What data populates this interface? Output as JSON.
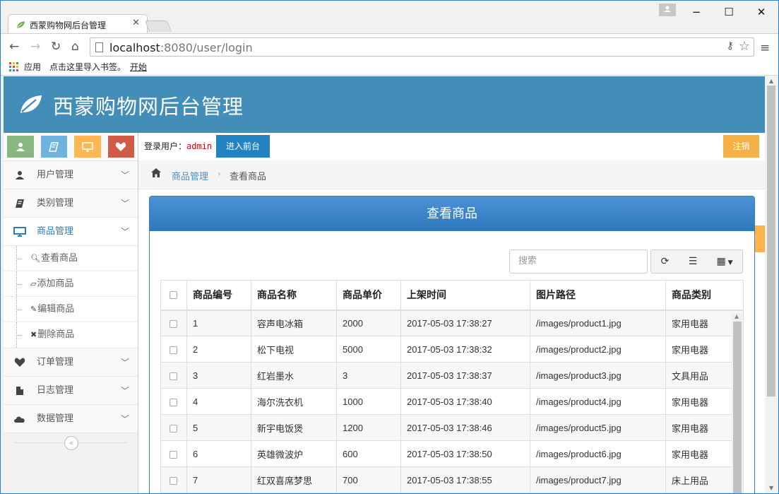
{
  "browser": {
    "tab_title": "西蒙购物网后台管理",
    "url_host": "localhost",
    "url_rest": ":8080/user/login",
    "bookmarks": {
      "apps": "应用",
      "import": "点击这里导入书签。",
      "start": "开始"
    }
  },
  "header": {
    "title": "西蒙购物网后台管理",
    "brand_color": "#438eb9"
  },
  "shortcut_colors": [
    "#87b87f",
    "#6fb3e0",
    "#ffb752",
    "#d15b47"
  ],
  "sidebar": {
    "items": [
      {
        "label": "用户管理",
        "icon": "user-icon"
      },
      {
        "label": "类别管理",
        "icon": "book-icon"
      },
      {
        "label": "商品管理",
        "icon": "desktop-icon",
        "active": true
      },
      {
        "label": "订单管理",
        "icon": "heart-icon"
      },
      {
        "label": "日志管理",
        "icon": "file-icon"
      },
      {
        "label": "数据管理",
        "icon": "cloud-icon"
      }
    ],
    "submenu": [
      {
        "label": "查看商品",
        "icon": "search-icon"
      },
      {
        "label": "添加商品",
        "icon": "eraser-icon"
      },
      {
        "label": "编辑商品",
        "icon": "edit-icon"
      },
      {
        "label": "删除商品",
        "icon": "close-icon"
      }
    ]
  },
  "userbar": {
    "login_label": "登录用户：",
    "username": "admin",
    "front_button": "进入前台",
    "logout_button": "注销"
  },
  "breadcrumb": {
    "section": "商品管理",
    "current": "查看商品"
  },
  "panel": {
    "title": "查看商品",
    "search_placeholder": "搜索",
    "columns": [
      "商品编号",
      "商品名称",
      "商品单价",
      "上架时间",
      "图片路径",
      "商品类别"
    ],
    "rows": [
      [
        "1",
        "容声电冰箱",
        "2000",
        "2017-05-03 17:38:27",
        "/images/product1.jpg",
        "家用电器"
      ],
      [
        "2",
        "松下电视",
        "5000",
        "2017-05-03 17:38:32",
        "/images/product2.jpg",
        "家用电器"
      ],
      [
        "3",
        "红岩墨水",
        "3",
        "2017-05-03 17:38:37",
        "/images/product3.jpg",
        "文具用品"
      ],
      [
        "4",
        "海尔洗衣机",
        "1000",
        "2017-05-03 17:38:40",
        "/images/product4.jpg",
        "家用电器"
      ],
      [
        "5",
        "新宇电饭煲",
        "1200",
        "2017-05-03 17:38:46",
        "/images/product5.jpg",
        "家用电器"
      ],
      [
        "6",
        "英雄微波炉",
        "600",
        "2017-05-03 17:38:50",
        "/images/product6.jpg",
        "家用电器"
      ],
      [
        "7",
        "红双喜席梦思",
        "700",
        "2017-05-03 17:38:55",
        "/images/product7.jpg",
        "床上用品"
      ]
    ]
  }
}
